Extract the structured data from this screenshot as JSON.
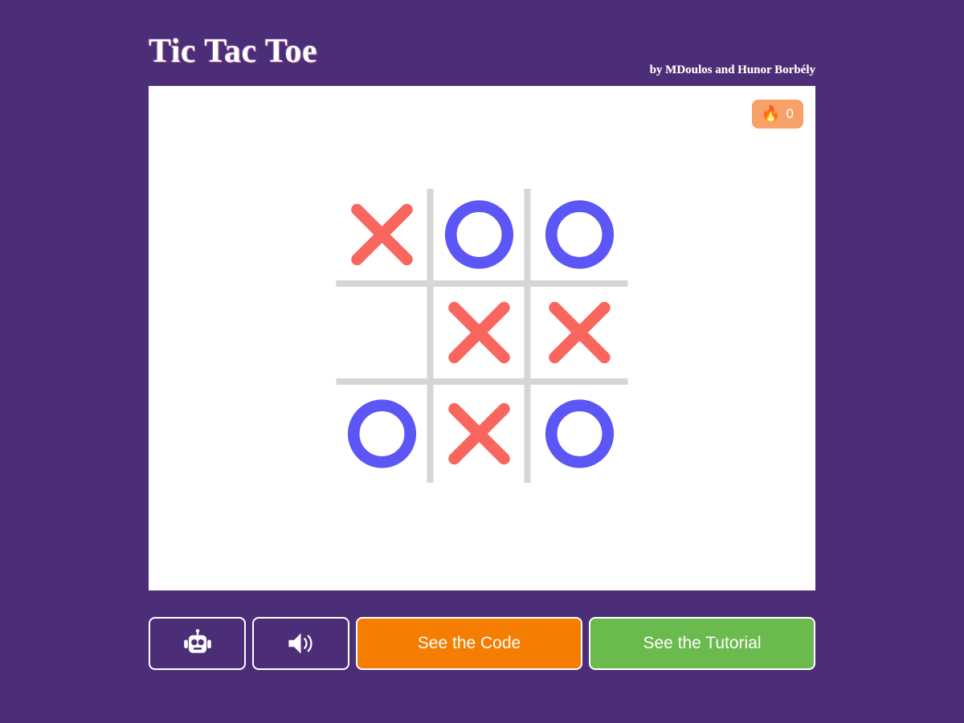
{
  "header": {
    "title": "Tic Tac Toe",
    "byline": "by MDoulos and Hunor Borbély"
  },
  "panel": {
    "streak_badge": {
      "icon": "fire-icon",
      "glyph": "🔥",
      "count": "0",
      "background": "#f7a168"
    }
  },
  "board": {
    "x_color": "#f9665e",
    "o_color": "#5b56f5",
    "grid_color": "#d6d6d6",
    "cells": [
      {
        "index": 0,
        "mark": "X",
        "name": "board-cell-0"
      },
      {
        "index": 1,
        "mark": "O",
        "name": "board-cell-1"
      },
      {
        "index": 2,
        "mark": "O",
        "name": "board-cell-2"
      },
      {
        "index": 3,
        "mark": "",
        "name": "board-cell-3"
      },
      {
        "index": 4,
        "mark": "X",
        "name": "board-cell-4"
      },
      {
        "index": 5,
        "mark": "X",
        "name": "board-cell-5"
      },
      {
        "index": 6,
        "mark": "O",
        "name": "board-cell-6"
      },
      {
        "index": 7,
        "mark": "X",
        "name": "board-cell-7"
      },
      {
        "index": 8,
        "mark": "O",
        "name": "board-cell-8"
      }
    ]
  },
  "controls": {
    "robot_button": {
      "icon": "robot-icon",
      "label": ""
    },
    "sound_button": {
      "icon": "speaker-icon",
      "label": ""
    },
    "code_button": {
      "label": "See the Code",
      "color": "#f57d01"
    },
    "tutorial_button": {
      "label": "See the Tutorial",
      "color": "#6aba4d"
    }
  },
  "theme": {
    "background": "#4c2e78",
    "panel_background": "#ffffff"
  }
}
